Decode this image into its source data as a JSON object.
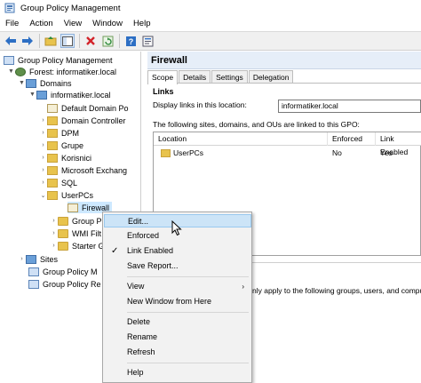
{
  "window": {
    "title": "Group Policy Management"
  },
  "menu": [
    "File",
    "Action",
    "View",
    "Window",
    "Help"
  ],
  "toolbar_icons": [
    "back-icon",
    "forward-icon",
    "up-folder-icon",
    "show-pane-icon",
    "delete-icon",
    "refresh-icon",
    "help-icon",
    "properties-icon"
  ],
  "tree": {
    "root": "Group Policy Management",
    "forest": "Forest: informatiker.local",
    "domains": "Domains",
    "domain": "informatiker.local",
    "items": [
      "Default Domain Po",
      "Domain Controller",
      "DPM",
      "Grupe",
      "Korisnici",
      "Microsoft Exchang",
      "SQL",
      "UserPCs"
    ],
    "gpo_selected": "Firewall",
    "after": [
      "Group P",
      "WMI Filt",
      "Starter G"
    ],
    "sites": "Sites",
    "bottom": [
      "Group Policy M",
      "Group Policy Re"
    ]
  },
  "right": {
    "title": "Firewall",
    "tabs": [
      "Scope",
      "Details",
      "Settings",
      "Delegation"
    ],
    "links_title": "Links",
    "location_label": "Display links in this location:",
    "location_value": "informatiker.local",
    "sites_label": "The following sites, domains, and OUs are linked to this GPO:",
    "columns": [
      "Location",
      "Enforced",
      "Link Enabled"
    ],
    "rows": [
      {
        "location": "UserPCs",
        "enforced": "No",
        "link_enabled": "Yes"
      }
    ],
    "filter_text": "nly apply to the following groups, users, and comput"
  },
  "context_menu": {
    "items": [
      {
        "label": "Edit...",
        "highlighted": true
      },
      {
        "label": "Enforced"
      },
      {
        "label": "Link Enabled",
        "checked": true
      },
      {
        "label": "Save Report..."
      },
      {
        "label": "View",
        "submenu": true
      },
      {
        "label": "New Window from Here"
      },
      {
        "label": "Delete"
      },
      {
        "label": "Rename"
      },
      {
        "label": "Refresh"
      },
      {
        "label": "Help"
      }
    ]
  },
  "colors": {
    "selection": "#cde8ff",
    "menu_highlight": "#cce4f7",
    "header_bg": "#e6eef8"
  }
}
